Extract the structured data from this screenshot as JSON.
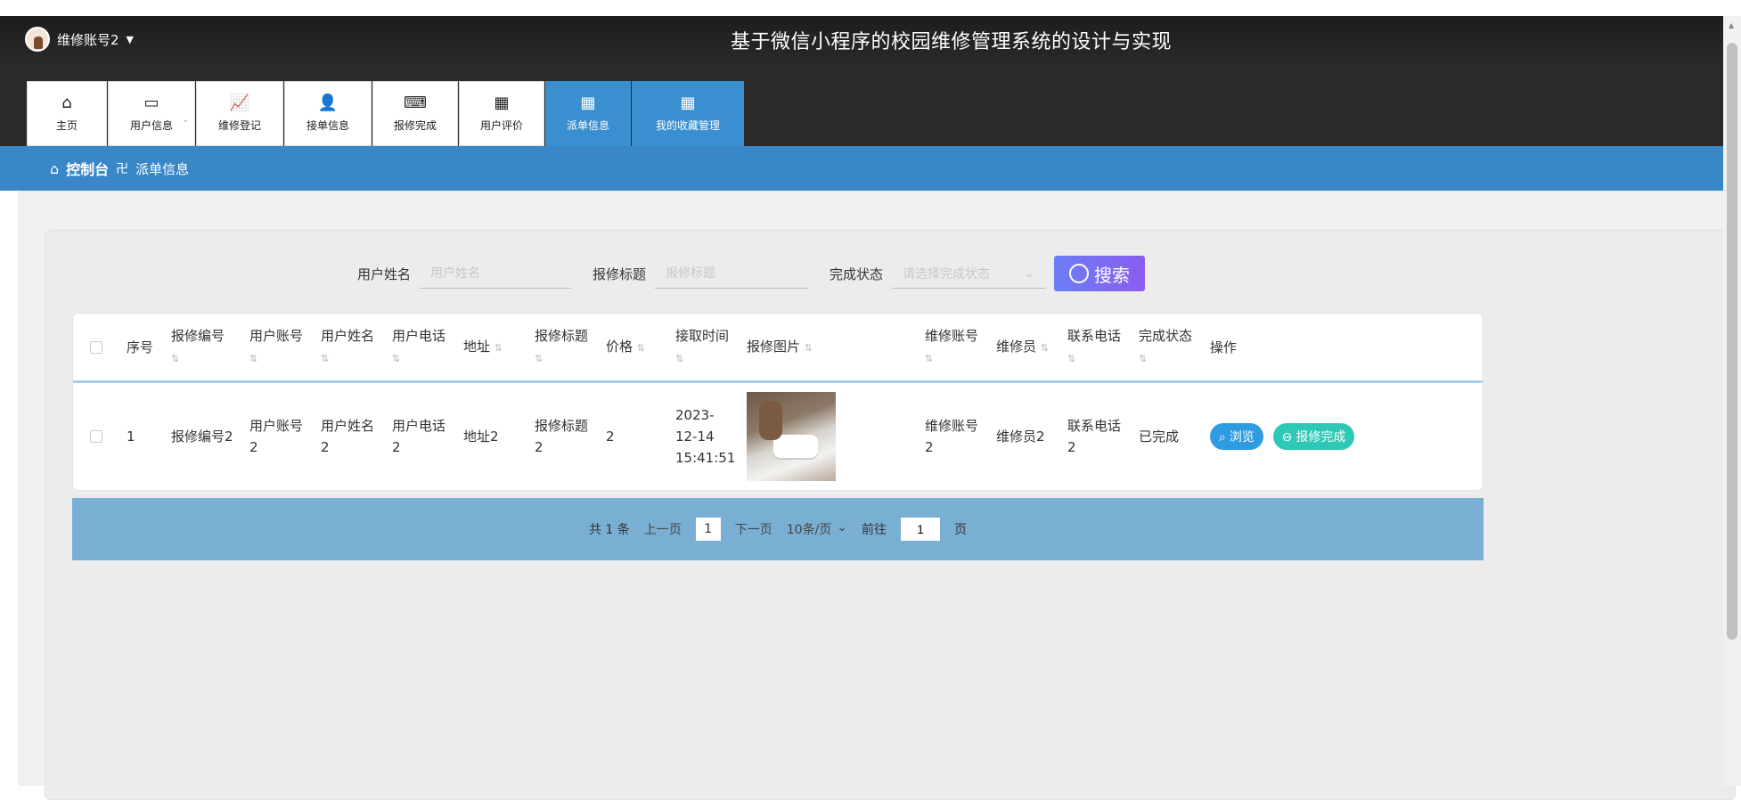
{
  "header": {
    "user_name": "维修账号2",
    "caret": "▼",
    "app_title": "基于微信小程序的校园维修管理系统的设计与实现"
  },
  "tabs": [
    {
      "icon": "⌂",
      "label": "主页"
    },
    {
      "icon": "▭",
      "label": "用户信息",
      "dropdown": "⌄"
    },
    {
      "icon": "📈",
      "label": "维修登记"
    },
    {
      "icon": "👤",
      "label": "接单信息"
    },
    {
      "icon": "⌨",
      "label": "报修完成"
    },
    {
      "icon": "▦",
      "label": "用户评价"
    },
    {
      "icon": "▦",
      "label": "派单信息",
      "active": true
    },
    {
      "icon": "▦",
      "label": "我的收藏管理",
      "active": true
    }
  ],
  "breadcrumb": {
    "home_icon": "⌂",
    "home": "控制台",
    "sep": "卍",
    "current": "派单信息"
  },
  "search": {
    "name_label": "用户姓名",
    "name_placeholder": "用户姓名",
    "title_label": "报修标题",
    "title_placeholder": "报修标题",
    "status_label": "完成状态",
    "status_placeholder": "请选择完成状态",
    "button_label": "搜索"
  },
  "table": {
    "headers": [
      "序号",
      "报修编号",
      "用户账号",
      "用户姓名",
      "用户电话",
      "地址",
      "报修标题",
      "价格",
      "接取时间",
      "报修图片",
      "维修账号",
      "维修员",
      "联系电话",
      "完成状态",
      "操作"
    ],
    "sort_icon": "⇅",
    "rows": [
      {
        "index": "1",
        "repair_no": "报修编号2",
        "account": "用户账号2",
        "user_name": "用户姓名2",
        "phone": "用户电话2",
        "address": "地址2",
        "title": "报修标题2",
        "price": "2",
        "time": "2023-12-14 15:41:51",
        "repair_account": "维修账号2",
        "repairer": "维修员2",
        "contact": "联系电话2",
        "status": "已完成",
        "btn_view": "浏览",
        "btn_done": "报修完成"
      }
    ]
  },
  "pager": {
    "total": "共 1 条",
    "prev": "上一页",
    "current": "1",
    "next": "下一页",
    "size": "10条/页",
    "size_caret": "⌄",
    "goto_label": "前往",
    "goto_value": "1",
    "goto_suffix": "页"
  }
}
